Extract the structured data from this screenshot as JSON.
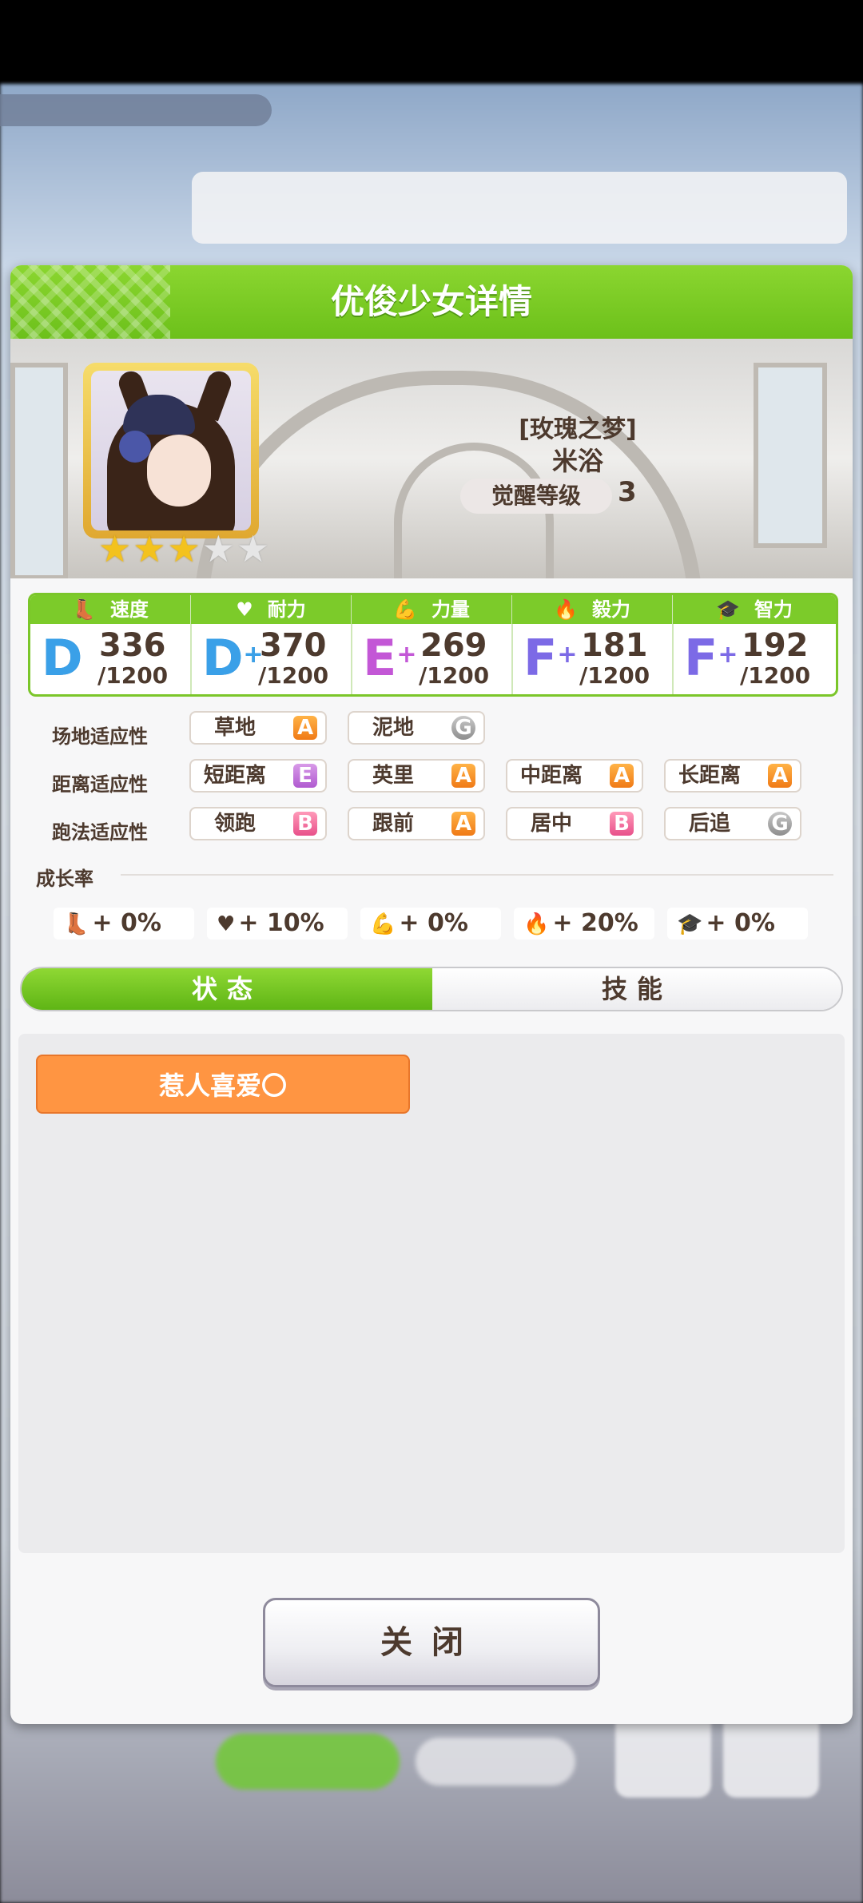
{
  "dialog": {
    "title": "优俊少女详情"
  },
  "character": {
    "epithet": "[玫瑰之梦]",
    "name": "米浴",
    "awaken_label": "觉醒等级",
    "awaken_value": "3",
    "stars_filled": 3,
    "stars_total": 5
  },
  "stats": [
    {
      "label": "速度",
      "icon": "shoe-icon",
      "grade": "D",
      "plus": "",
      "value": "336",
      "max": "/1200"
    },
    {
      "label": "耐力",
      "icon": "heart-icon",
      "grade": "D",
      "plus": "+",
      "value": "370",
      "max": "/1200"
    },
    {
      "label": "力量",
      "icon": "muscle-icon",
      "grade": "E",
      "plus": "+",
      "value": "269",
      "max": "/1200"
    },
    {
      "label": "毅力",
      "icon": "flame-icon",
      "grade": "F",
      "plus": "+",
      "value": "181",
      "max": "/1200"
    },
    {
      "label": "智力",
      "icon": "graduation-cap-icon",
      "grade": "F",
      "plus": "+",
      "value": "192",
      "max": "/1200"
    }
  ],
  "aptitude": {
    "track": {
      "label": "场地适应性",
      "items": [
        {
          "name": "草地",
          "grade": "A"
        },
        {
          "name": "泥地",
          "grade": "G"
        }
      ]
    },
    "distance": {
      "label": "距离适应性",
      "items": [
        {
          "name": "短距离",
          "grade": "E"
        },
        {
          "name": "英里",
          "grade": "A"
        },
        {
          "name": "中距离",
          "grade": "A"
        },
        {
          "name": "长距离",
          "grade": "A"
        }
      ]
    },
    "style": {
      "label": "跑法适应性",
      "items": [
        {
          "name": "领跑",
          "grade": "B"
        },
        {
          "name": "跟前",
          "grade": "A"
        },
        {
          "name": "居中",
          "grade": "B"
        },
        {
          "name": "后追",
          "grade": "G"
        }
      ]
    }
  },
  "growth": {
    "title": "成长率",
    "items": [
      {
        "icon": "shoe-icon",
        "value": "+ 0%"
      },
      {
        "icon": "heart-icon",
        "value": "+ 10%"
      },
      {
        "icon": "muscle-icon",
        "value": "+ 0%"
      },
      {
        "icon": "flame-icon",
        "value": "+ 20%"
      },
      {
        "icon": "graduation-cap-icon",
        "value": "+ 0%"
      }
    ]
  },
  "tabs": {
    "status": "状态",
    "skills": "技能"
  },
  "status": {
    "chip": "惹人喜爱〇"
  },
  "close_label": "关闭",
  "colors": {
    "accent_green": "#7ccb2a",
    "status_orange": "#ff9542",
    "text_brown": "#4d3a2e"
  }
}
